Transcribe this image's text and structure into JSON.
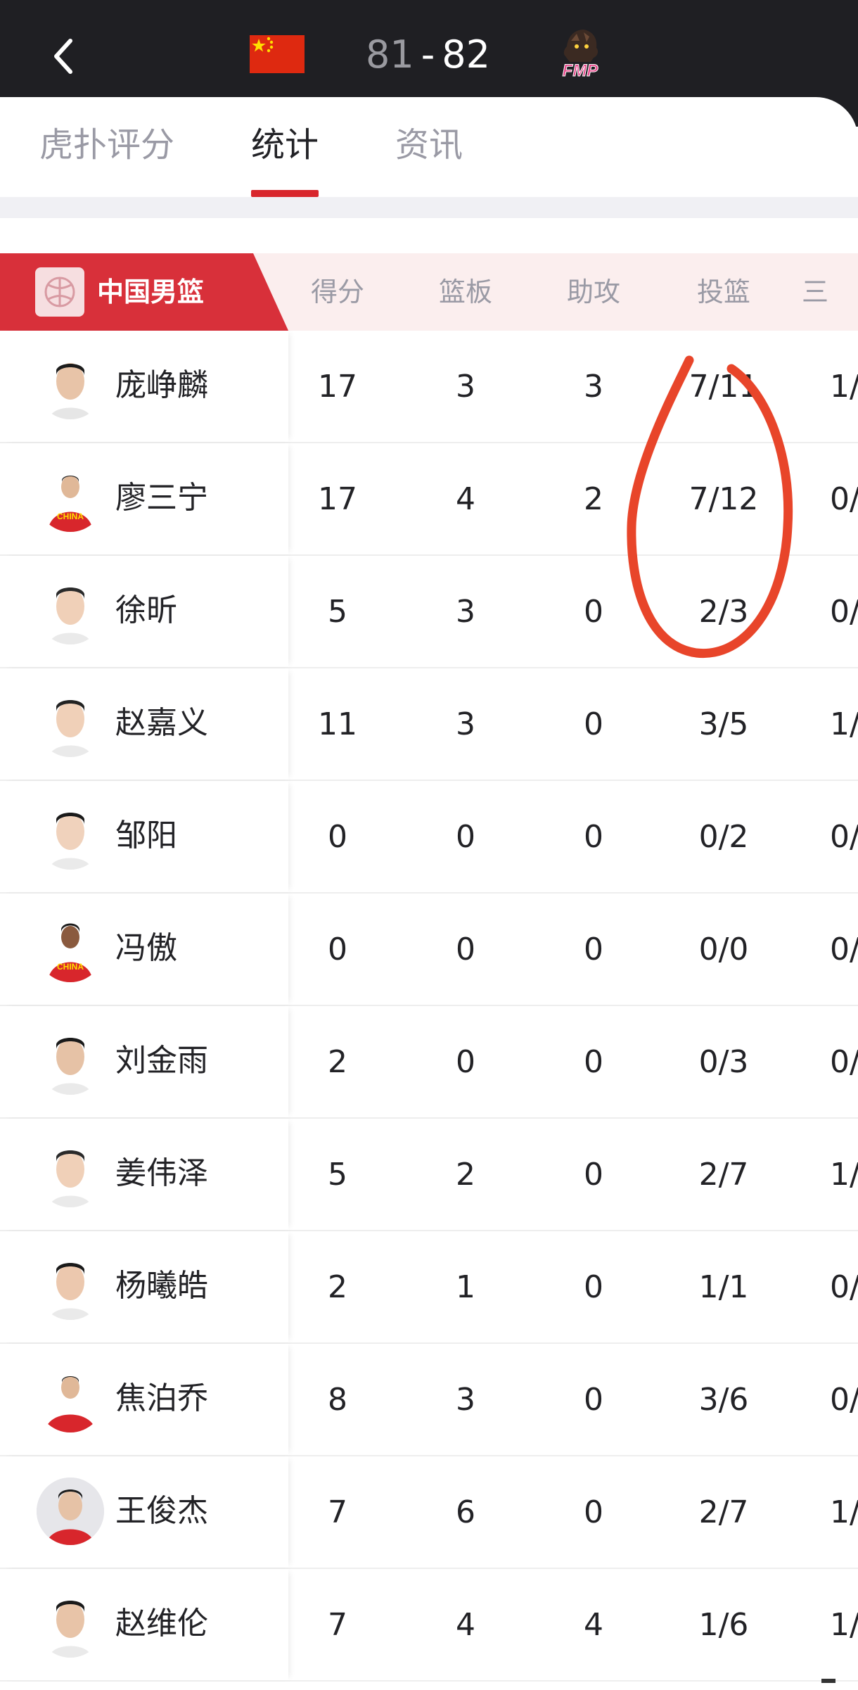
{
  "header": {
    "back_icon": "chevron-left-icon",
    "home_flag": "china-flag-icon",
    "home_score": "81",
    "separator": "-",
    "away_score": "82",
    "away_logo_text": "FMP"
  },
  "tabs": [
    {
      "label": "虎扑评分",
      "active": false
    },
    {
      "label": "统计",
      "active": true
    },
    {
      "label": "资讯",
      "active": false
    }
  ],
  "table": {
    "team_name": "中国男篮",
    "columns": [
      "得分",
      "篮板",
      "助攻",
      "投篮",
      "三"
    ],
    "rows": [
      {
        "name": "庞峥麟",
        "pts": "17",
        "reb": "3",
        "ast": "3",
        "fg": "7/11",
        "three": "1/"
      },
      {
        "name": "廖三宁",
        "pts": "17",
        "reb": "4",
        "ast": "2",
        "fg": "7/12",
        "three": "0/"
      },
      {
        "name": "徐昕",
        "pts": "5",
        "reb": "3",
        "ast": "0",
        "fg": "2/3",
        "three": "0/"
      },
      {
        "name": "赵嘉义",
        "pts": "11",
        "reb": "3",
        "ast": "0",
        "fg": "3/5",
        "three": "1/"
      },
      {
        "name": "邹阳",
        "pts": "0",
        "reb": "0",
        "ast": "0",
        "fg": "0/2",
        "three": "0/"
      },
      {
        "name": "冯傲",
        "pts": "0",
        "reb": "0",
        "ast": "0",
        "fg": "0/0",
        "three": "0/"
      },
      {
        "name": "刘金雨",
        "pts": "2",
        "reb": "0",
        "ast": "0",
        "fg": "0/3",
        "three": "0/"
      },
      {
        "name": "姜伟泽",
        "pts": "5",
        "reb": "2",
        "ast": "0",
        "fg": "2/7",
        "three": "1/"
      },
      {
        "name": "杨曦皓",
        "pts": "2",
        "reb": "1",
        "ast": "0",
        "fg": "1/1",
        "three": "0/"
      },
      {
        "name": "焦泊乔",
        "pts": "8",
        "reb": "3",
        "ast": "0",
        "fg": "3/6",
        "three": "0/"
      },
      {
        "name": "王俊杰",
        "pts": "7",
        "reb": "6",
        "ast": "0",
        "fg": "2/7",
        "three": "1/"
      },
      {
        "name": "赵维伦",
        "pts": "7",
        "reb": "4",
        "ast": "4",
        "fg": "1/6",
        "three": "1/"
      }
    ]
  },
  "colors": {
    "topbar": "#1f1f23",
    "accent": "#d8262c",
    "header_row_bg": "#fbeeee",
    "annotation": "#e8452a"
  }
}
